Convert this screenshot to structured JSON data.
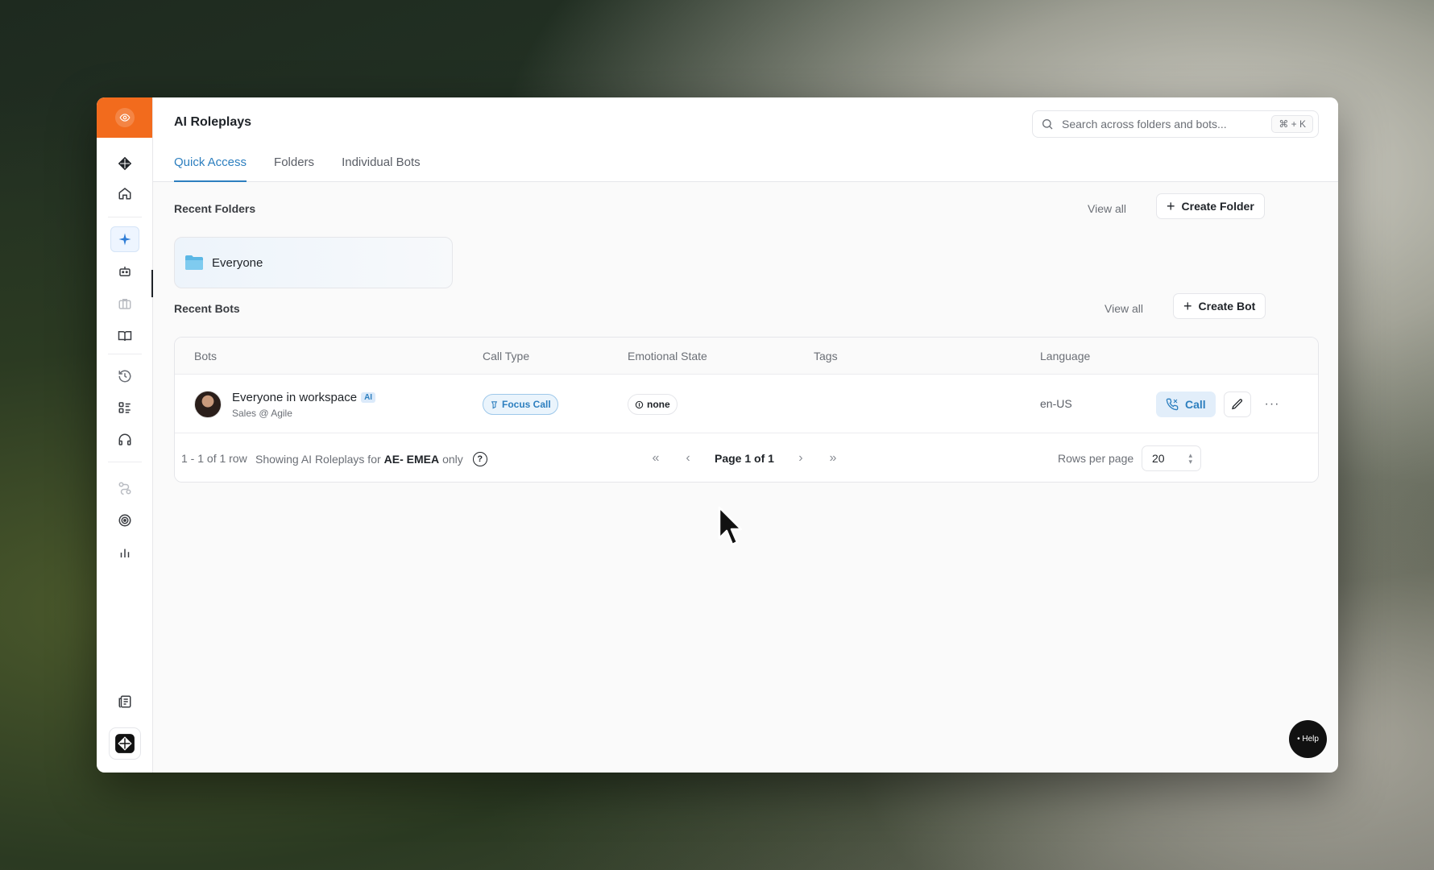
{
  "app": {
    "title": "AI Roleplays",
    "tabs": [
      {
        "label": "Quick Access",
        "active": true
      },
      {
        "label": "Folders",
        "active": false
      },
      {
        "label": "Individual Bots",
        "active": false
      }
    ],
    "search": {
      "placeholder": "Search across folders and bots...",
      "shortcut": "⌘ + K"
    }
  },
  "sidebar": {
    "items": [
      {
        "icon": "eye-icon"
      },
      {
        "icon": "brand-logo-icon"
      },
      {
        "icon": "home-icon"
      },
      {
        "icon": "sparkle-icon"
      },
      {
        "icon": "bot-icon",
        "active": true
      },
      {
        "icon": "briefcase-icon"
      },
      {
        "icon": "book-icon"
      },
      {
        "icon": "history-icon"
      },
      {
        "icon": "list-icon"
      },
      {
        "icon": "headset-icon"
      },
      {
        "icon": "route-icon"
      },
      {
        "icon": "target-icon"
      },
      {
        "icon": "chart-icon"
      },
      {
        "icon": "newspaper-icon"
      },
      {
        "icon": "workspace-logo-icon"
      }
    ]
  },
  "recent_folders": {
    "title": "Recent Folders",
    "view_all": "View all",
    "create_label": "Create Folder",
    "items": [
      {
        "label": "Everyone"
      }
    ]
  },
  "recent_bots": {
    "title": "Recent Bots",
    "view_all": "View all",
    "create_label": "Create Bot",
    "columns": [
      "Bots",
      "Call Type",
      "Emotional State",
      "Tags",
      "Language"
    ],
    "rows": [
      {
        "name": "Everyone in workspace",
        "badge": "AI",
        "subtitle": "Sales @ Agile",
        "call_type": "Focus Call",
        "emotional_state": "none",
        "tags": "",
        "language": "en-US",
        "call_label": "Call"
      }
    ],
    "footer": {
      "rows_count": "1 - 1 of 1 row",
      "showing_prefix": "Showing AI Roleplays for",
      "showing_team": "AE- EMEA",
      "showing_suffix": "only",
      "page_label": "Page 1 of 1",
      "rows_per_page_label": "Rows per page",
      "rows_per_page": "20"
    }
  },
  "help": {
    "label": "• Help"
  },
  "colors": {
    "accent": "#2d7fbf",
    "brand_orange": "#f26b1d"
  }
}
